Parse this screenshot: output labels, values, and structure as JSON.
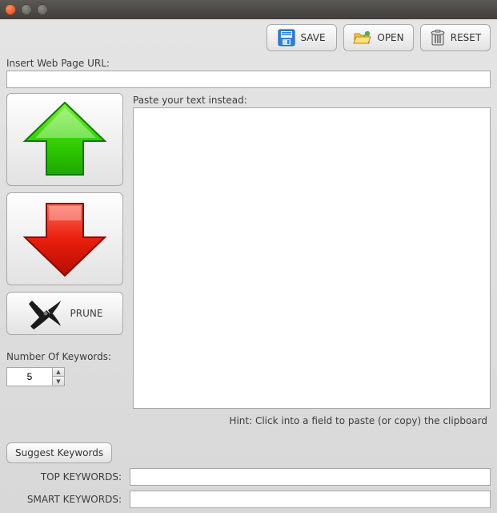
{
  "toolbar": {
    "save_label": "SAVE",
    "open_label": "OPEN",
    "reset_label": "RESET"
  },
  "url_section": {
    "label": "Insert Web Page URL:",
    "value": ""
  },
  "text_section": {
    "label": "Paste your text instead:",
    "value": ""
  },
  "prune_label": "PRUNE",
  "keywords": {
    "count_label": "Number Of Keywords:",
    "count_value": "5",
    "suggest_label": "Suggest Keywords",
    "top_label": "TOP KEYWORDS:",
    "top_value": "",
    "smart_label": "SMART KEYWORDS:",
    "smart_value": ""
  },
  "hint": "Hint: Click into a field to paste (or copy) the clipboard"
}
